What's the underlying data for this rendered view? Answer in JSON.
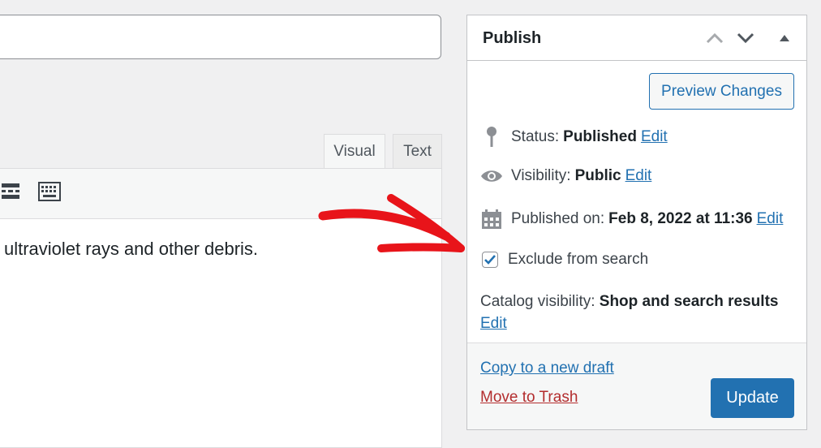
{
  "editor": {
    "tabs": [
      {
        "label": "Visual"
      },
      {
        "label": "Text"
      }
    ],
    "content_text": "ultraviolet rays and other debris."
  },
  "publish_box": {
    "title": "Publish",
    "preview_label": "Preview Changes",
    "status": {
      "label": "Status:",
      "value": "Published",
      "edit": "Edit"
    },
    "visibility": {
      "label": "Visibility:",
      "value": "Public",
      "edit": "Edit"
    },
    "published_on": {
      "label": "Published on:",
      "value": "Feb 8, 2022 at 11:36",
      "edit": "Edit"
    },
    "exclude_search": {
      "label": "Exclude from search",
      "checked": true
    },
    "catalog": {
      "label": "Catalog visibility:",
      "value": "Shop and search results",
      "edit": "Edit"
    },
    "copy_draft_label": "Copy to a new draft",
    "trash_label": "Move to Trash",
    "update_label": "Update"
  },
  "colors": {
    "accent": "#2271b1",
    "danger": "#b32d2e",
    "annotation_arrow": "#e8141a"
  }
}
